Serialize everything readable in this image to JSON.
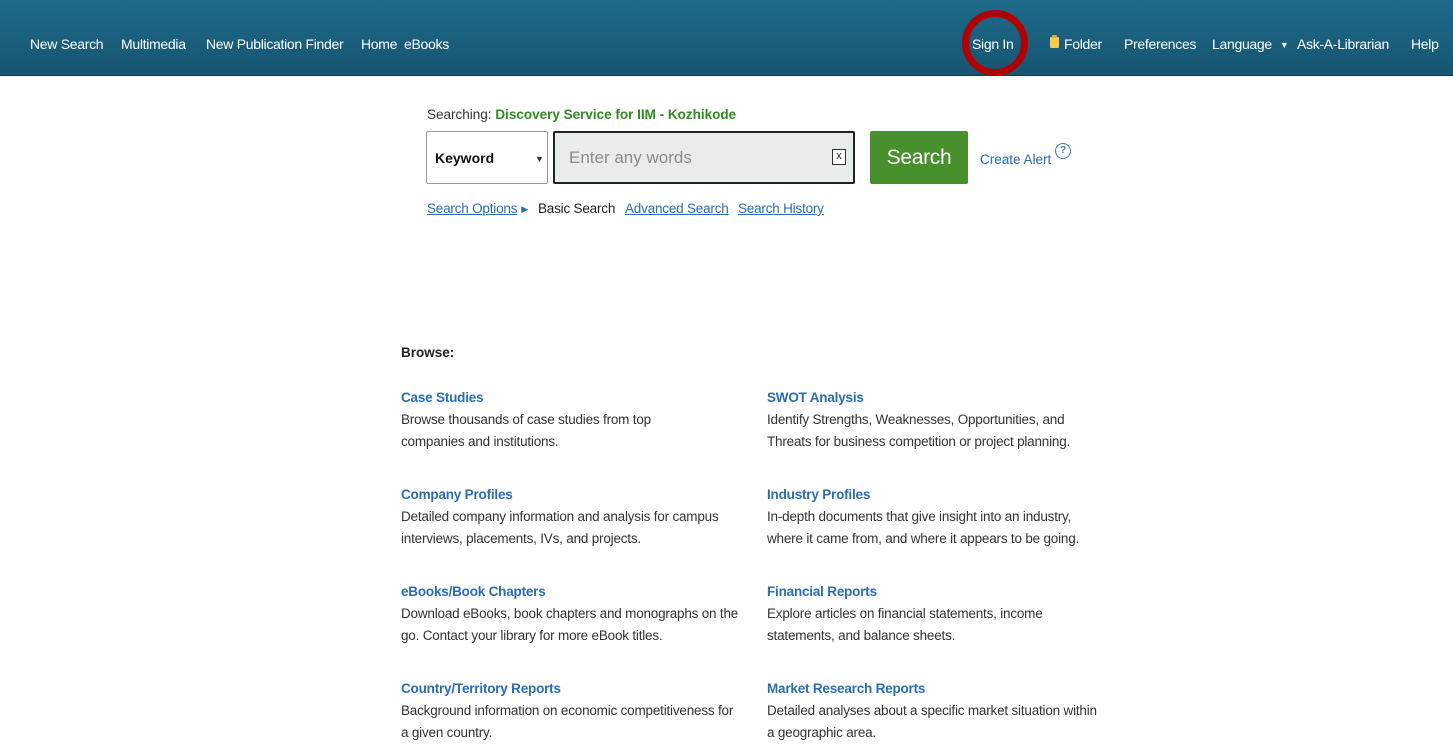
{
  "topnav": {
    "left": [
      "New Search",
      "Multimedia",
      "New Publication Finder",
      "Home",
      "eBooks"
    ],
    "sign_in": "Sign In",
    "folder": "Folder",
    "preferences": "Preferences",
    "language": "Language",
    "ask": "Ask-A-Librarian",
    "help": "Help"
  },
  "colors": {
    "topbar": "#1b6380",
    "search_button": "#47902c",
    "link": "#2a6db5",
    "highlight_ring": "#b00000",
    "database_name": "#2e8b1f"
  },
  "search": {
    "searching_label": "Searching:",
    "database": "Discovery Service for IIM - Kozhikode",
    "field_value": "Keyword",
    "placeholder": "Enter any words",
    "clear": "x",
    "button": "Search",
    "create_alert": "Create Alert",
    "help_icon": "?",
    "options": "Search Options",
    "basic": "Basic Search",
    "advanced": "Advanced Search",
    "history": "Search History"
  },
  "browse": {
    "heading": "Browse:",
    "items": [
      {
        "title": "Case Studies",
        "desc": "Browse thousands of case studies from top companies and institutions."
      },
      {
        "title": "SWOT Analysis",
        "desc": "Identify Strengths, Weaknesses, Opportunities, and Threats for business competition or project planning."
      },
      {
        "title": "Company Profiles",
        "desc": "Detailed company information and analysis for campus interviews, placements, IVs, and projects."
      },
      {
        "title": "Industry Profiles",
        "desc": "In-depth documents that give insight into an industry, where it came from, and where it appears to be going."
      },
      {
        "title": "eBooks/Book Chapters",
        "desc": "Download eBooks, book chapters and monographs on the go. Contact your library for more eBook titles."
      },
      {
        "title": "Financial Reports",
        "desc": "Explore articles on financial statements, income statements, and balance sheets."
      },
      {
        "title": "Country/Territory Reports",
        "desc": "Background information on economic competitiveness for a given country."
      },
      {
        "title": "Market Research Reports",
        "desc": "Detailed analyses about a specific market situation within a geographic area."
      }
    ]
  }
}
